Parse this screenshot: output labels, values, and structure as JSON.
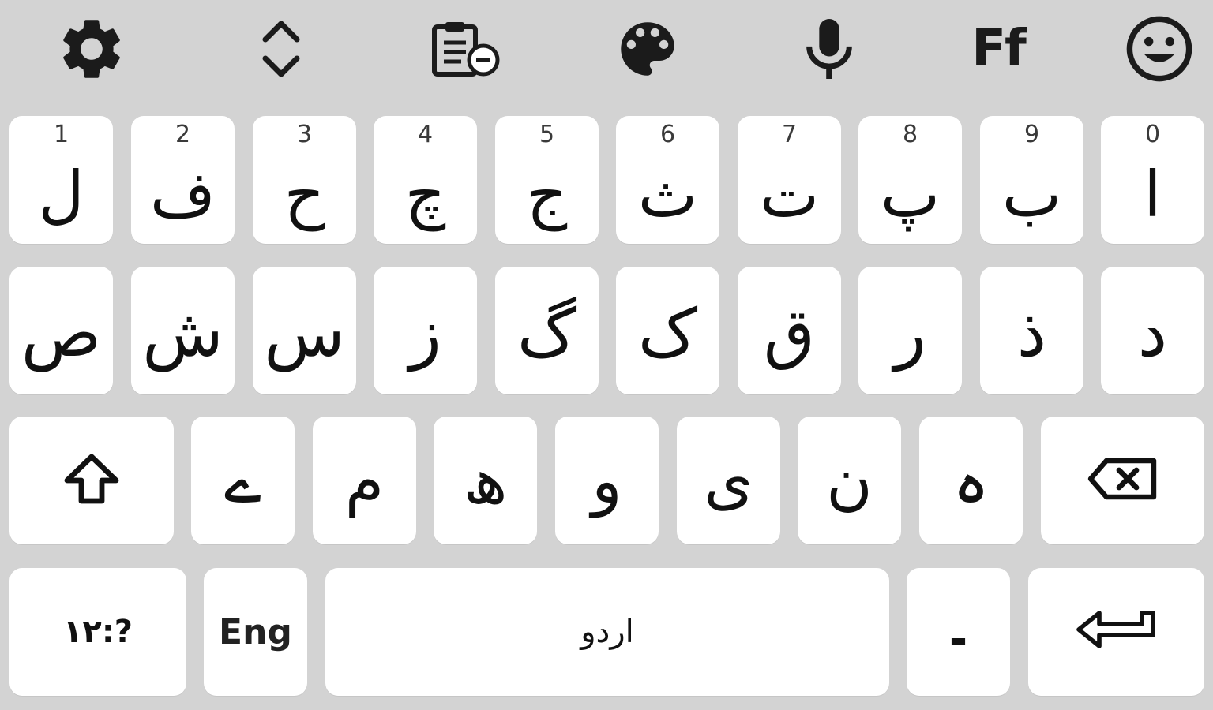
{
  "colors": {
    "background": "#d3d3d3",
    "key": "#ffffff",
    "icon": "#1b1b1b"
  },
  "toolbar": {
    "items": [
      {
        "icon": "gear-icon"
      },
      {
        "icon": "chevron-up-down-icon"
      },
      {
        "icon": "clipboard-icon"
      },
      {
        "icon": "palette-icon"
      },
      {
        "icon": "microphone-icon"
      },
      {
        "icon": "font-icon",
        "label": "Ff"
      },
      {
        "icon": "emoji-icon"
      }
    ]
  },
  "keyboard": {
    "row1": [
      {
        "num": "1",
        "char": "ل"
      },
      {
        "num": "2",
        "char": "ف"
      },
      {
        "num": "3",
        "char": "ح"
      },
      {
        "num": "4",
        "char": "چ"
      },
      {
        "num": "5",
        "char": "ج"
      },
      {
        "num": "6",
        "char": "ث"
      },
      {
        "num": "7",
        "char": "ت"
      },
      {
        "num": "8",
        "char": "پ"
      },
      {
        "num": "9",
        "char": "ب"
      },
      {
        "num": "0",
        "char": "ا"
      }
    ],
    "row2": [
      "ص",
      "ش",
      "س",
      "ز",
      "گ",
      "ک",
      "ق",
      "ر",
      "ذ",
      "د"
    ],
    "row3": [
      "ے",
      "م",
      "ھ",
      "و",
      "ی",
      "ن",
      "ہ"
    ],
    "shift": {
      "icon": "shift-icon"
    },
    "backspace": {
      "icon": "backspace-icon"
    },
    "symbols_label": "۱۲:?",
    "eng_label": "Eng",
    "space_label": "اردو",
    "dash_label": "-",
    "enter": {
      "icon": "enter-icon"
    }
  }
}
